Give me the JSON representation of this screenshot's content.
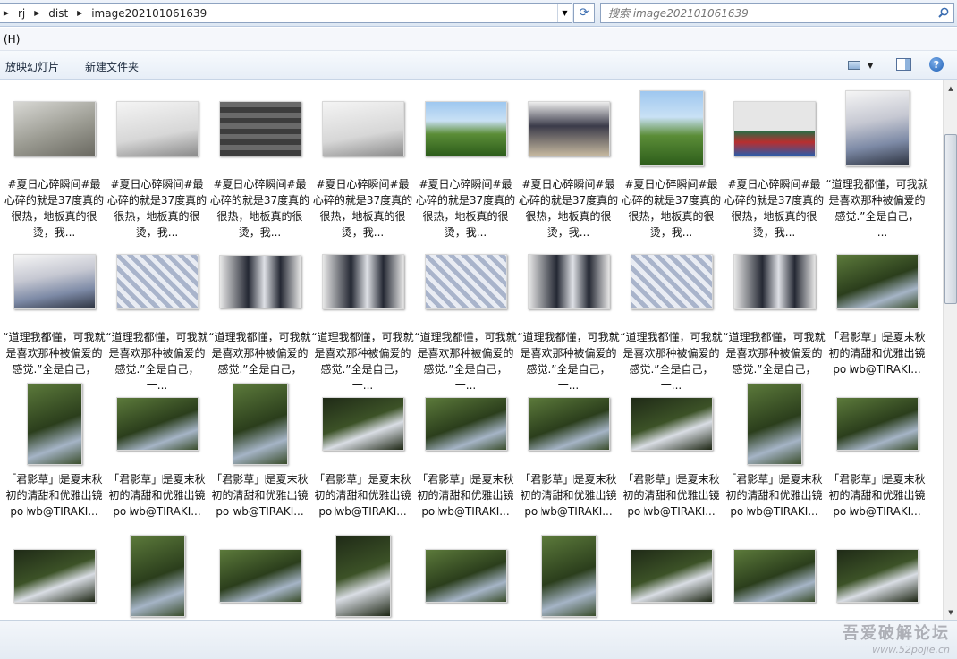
{
  "address": {
    "crumbs": [
      "rj",
      "dist",
      "image202101061639"
    ]
  },
  "search": {
    "placeholder": "搜索 image202101061639"
  },
  "menu": {
    "help_label": "(H)"
  },
  "toolbar": {
    "slideshow_label": "放映幻灯片",
    "new_folder_label": "新建文件夹"
  },
  "labels": {
    "summer": "#夏日心碎瞬间#最心碎的就是37度真的很热，地板真的很烫，我...",
    "truth": "“道理我都懂，可我就是喜欢那种被偏爱的感觉.”全是自己，一...",
    "grass": "「君影草」𝄀是夏末秋初的清甜和优雅出镜 po 𝄀wb@TIRAKI..."
  },
  "files": [
    {
      "label": "#夏日心碎瞬间#最心碎的就是37度真的很热，地板真的很烫，我...",
      "style": "t-grey",
      "orient": "landscape"
    },
    {
      "label": "#夏日心碎瞬间#最心碎的就是37度真的很热，地板真的很烫，我...",
      "style": "t-white",
      "orient": "landscape"
    },
    {
      "label": "#夏日心碎瞬间#最心碎的就是37度真的很热，地板真的很烫，我...",
      "style": "t-stairs",
      "orient": "landscape"
    },
    {
      "label": "#夏日心碎瞬间#最心碎的就是37度真的很热，地板真的很烫，我...",
      "style": "t-white",
      "orient": "landscape"
    },
    {
      "label": "#夏日心碎瞬间#最心碎的就是37度真的很热，地板真的很烫，我...",
      "style": "t-green",
      "orient": "landscape"
    },
    {
      "label": "#夏日心碎瞬间#最心碎的就是37度真的很热，地板真的很烫，我...",
      "style": "t-girl",
      "orient": "landscape"
    },
    {
      "label": "#夏日心碎瞬间#最心碎的就是37度真的很热，地板真的很烫，我...",
      "style": "t-green",
      "orient": "portrait-sm"
    },
    {
      "label": "#夏日心碎瞬间#最心碎的就是37度真的很热，地板真的很烫，我...",
      "style": "t-bins",
      "orient": "landscape"
    },
    {
      "label": "“道理我都懂，可我就是喜欢那种被偏爱的感觉.”全是自己，一...",
      "style": "t-shirt",
      "orient": "portrait-sm"
    },
    {
      "label": "“道理我都懂，可我就是喜欢那种被偏爱的感觉.”全是自己，一...",
      "style": "t-shirt",
      "orient": "landscape"
    },
    {
      "label": "“道理我都懂，可我就是喜欢那种被偏爱的感觉.”全是自己，一...",
      "style": "t-plaid",
      "orient": "landscape"
    },
    {
      "label": "“道理我都懂，可我就是喜欢那种被偏爱的感觉.”全是自己，一...",
      "style": "t-suit",
      "orient": "landscape-sm"
    },
    {
      "label": "“道理我都懂，可我就是喜欢那种被偏爱的感觉.”全是自己，一...",
      "style": "t-suit",
      "orient": "landscape"
    },
    {
      "label": "“道理我都懂，可我就是喜欢那种被偏爱的感觉.”全是自己，一...",
      "style": "t-plaid",
      "orient": "landscape"
    },
    {
      "label": "“道理我都懂，可我就是喜欢那种被偏爱的感觉.”全是自己，一...",
      "style": "t-suit",
      "orient": "landscape"
    },
    {
      "label": "“道理我都懂，可我就是喜欢那种被偏爱的感觉.”全是自己，一...",
      "style": "t-plaid",
      "orient": "landscape"
    },
    {
      "label": "“道理我都懂，可我就是喜欢那种被偏爱的感觉.”全是自己，一...",
      "style": "t-suit",
      "orient": "landscape"
    },
    {
      "label": "「君影草」𝄀是夏末秋初的清甜和优雅出镜 po 𝄀wb@TIRAKI...",
      "style": "t-forest",
      "orient": "landscape"
    },
    {
      "label": "「君影草」𝄀是夏末秋初的清甜和优雅出镜 po 𝄀wb@TIRAKI...",
      "style": "t-forest",
      "orient": "portrait"
    },
    {
      "label": "「君影草」𝄀是夏末秋初的清甜和优雅出镜 po 𝄀wb@TIRAKI...",
      "style": "t-forest",
      "orient": "landscape-sm"
    },
    {
      "label": "「君影草」𝄀是夏末秋初的清甜和优雅出镜 po 𝄀wb@TIRAKI...",
      "style": "t-forest",
      "orient": "portrait"
    },
    {
      "label": "「君影草」𝄀是夏末秋初的清甜和优雅出镜 po 𝄀wb@TIRAKI...",
      "style": "t-dark",
      "orient": "landscape-sm"
    },
    {
      "label": "「君影草」𝄀是夏末秋初的清甜和优雅出镜 po 𝄀wb@TIRAKI...",
      "style": "t-forest",
      "orient": "landscape-sm"
    },
    {
      "label": "「君影草」𝄀是夏末秋初的清甜和优雅出镜 po 𝄀wb@TIRAKI...",
      "style": "t-forest",
      "orient": "landscape-sm"
    },
    {
      "label": "「君影草」𝄀是夏末秋初的清甜和优雅出镜 po 𝄀wb@TIRAKI...",
      "style": "t-dark",
      "orient": "landscape-sm"
    },
    {
      "label": "「君影草」𝄀是夏末秋初的清甜和优雅出镜 po 𝄀wb@TIRAKI...",
      "style": "t-forest",
      "orient": "portrait"
    },
    {
      "label": "「君影草」𝄀是夏末秋初的清甜和优雅出镜 po 𝄀wb@TIRAKI...",
      "style": "t-forest",
      "orient": "landscape-sm"
    },
    {
      "label": "",
      "style": "t-dark",
      "orient": "landscape-sm"
    },
    {
      "label": "",
      "style": "t-forest",
      "orient": "portrait"
    },
    {
      "label": "",
      "style": "t-forest",
      "orient": "landscape-sm"
    },
    {
      "label": "",
      "style": "t-dark",
      "orient": "portrait"
    },
    {
      "label": "",
      "style": "t-forest",
      "orient": "landscape-sm"
    },
    {
      "label": "",
      "style": "t-forest",
      "orient": "portrait"
    },
    {
      "label": "",
      "style": "t-dark",
      "orient": "landscape-sm"
    },
    {
      "label": "",
      "style": "t-forest",
      "orient": "landscape-sm"
    },
    {
      "label": "",
      "style": "t-dark",
      "orient": "landscape-sm"
    }
  ],
  "watermark": {
    "line1": "吾爱破解论坛",
    "line2": "www.52pojie.cn"
  },
  "icons": {
    "search": "search-icon",
    "refresh": "refresh-icon",
    "views": "views-icon",
    "preview_pane": "preview-pane-icon",
    "help": "help-icon"
  },
  "colors": {
    "accent": "#3a6cb0",
    "toolbar_bg": "#e7eef7"
  }
}
